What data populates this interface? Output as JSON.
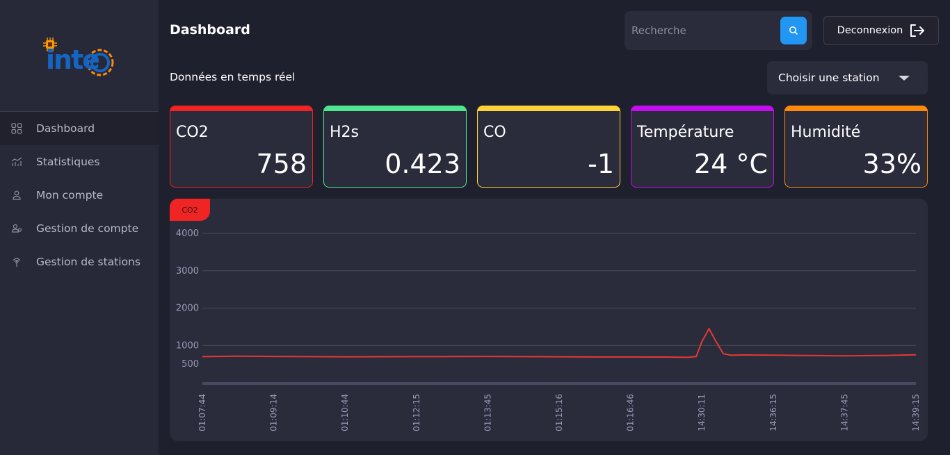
{
  "brand": {
    "logo_text": "inte"
  },
  "sidebar": {
    "items": [
      {
        "label": "Dashboard",
        "icon": "grid-icon"
      },
      {
        "label": "Statistiques",
        "icon": "chart-icon"
      },
      {
        "label": "Mon compte",
        "icon": "user-icon"
      },
      {
        "label": "Gestion de compte",
        "icon": "users-icon"
      },
      {
        "label": "Gestion de stations",
        "icon": "antenna-icon"
      }
    ]
  },
  "header": {
    "title": "Dashboard",
    "search_placeholder": "Recherche",
    "logout_label": "Deconnexion"
  },
  "main": {
    "subtitle": "Données en temps réel",
    "station_select_label": "Choisir une station",
    "cards": [
      {
        "title": "CO2",
        "value": "758",
        "color": "#f02425"
      },
      {
        "title": "H2s",
        "value": "0.423",
        "color": "#4de68f"
      },
      {
        "title": "CO",
        "value": "-1",
        "color": "#fdd33a"
      },
      {
        "title": "Température",
        "value": "24 °C",
        "color": "#c50ef0"
      },
      {
        "title": "Humidité",
        "value": "33%",
        "color": "#ff8a0a"
      }
    ]
  },
  "chart_data": {
    "type": "line",
    "tag": "CO2",
    "title": "",
    "xlabel": "",
    "ylabel": "",
    "ylim": [
      0,
      4000
    ],
    "yticks": [
      500,
      1000,
      2000,
      3000,
      4000
    ],
    "grid": true,
    "line_color": "#e53935",
    "x_labels": [
      "01:07:44",
      "01:09:14",
      "01:10:44",
      "01:12:15",
      "01:13:45",
      "01:15:16",
      "01:16:46",
      "14:30:11",
      "14:36:15",
      "14:37:45",
      "14:39:15"
    ],
    "series": [
      {
        "name": "CO2",
        "points": [
          [
            0,
            700
          ],
          [
            0.5,
            710
          ],
          [
            1,
            705
          ],
          [
            1.5,
            700
          ],
          [
            2,
            695
          ],
          [
            2.5,
            698
          ],
          [
            3,
            700
          ],
          [
            3.5,
            702
          ],
          [
            4,
            705
          ],
          [
            4.5,
            700
          ],
          [
            5,
            695
          ],
          [
            5.5,
            690
          ],
          [
            6,
            690
          ],
          [
            6.5,
            688
          ],
          [
            6.8,
            680
          ],
          [
            6.92,
            700
          ],
          [
            7.0,
            1100
          ],
          [
            7.1,
            1450
          ],
          [
            7.2,
            1100
          ],
          [
            7.3,
            780
          ],
          [
            7.4,
            740
          ],
          [
            7.6,
            745
          ],
          [
            8,
            740
          ],
          [
            8.5,
            730
          ],
          [
            9,
            720
          ],
          [
            9.5,
            730
          ],
          [
            10,
            750
          ]
        ]
      }
    ]
  }
}
